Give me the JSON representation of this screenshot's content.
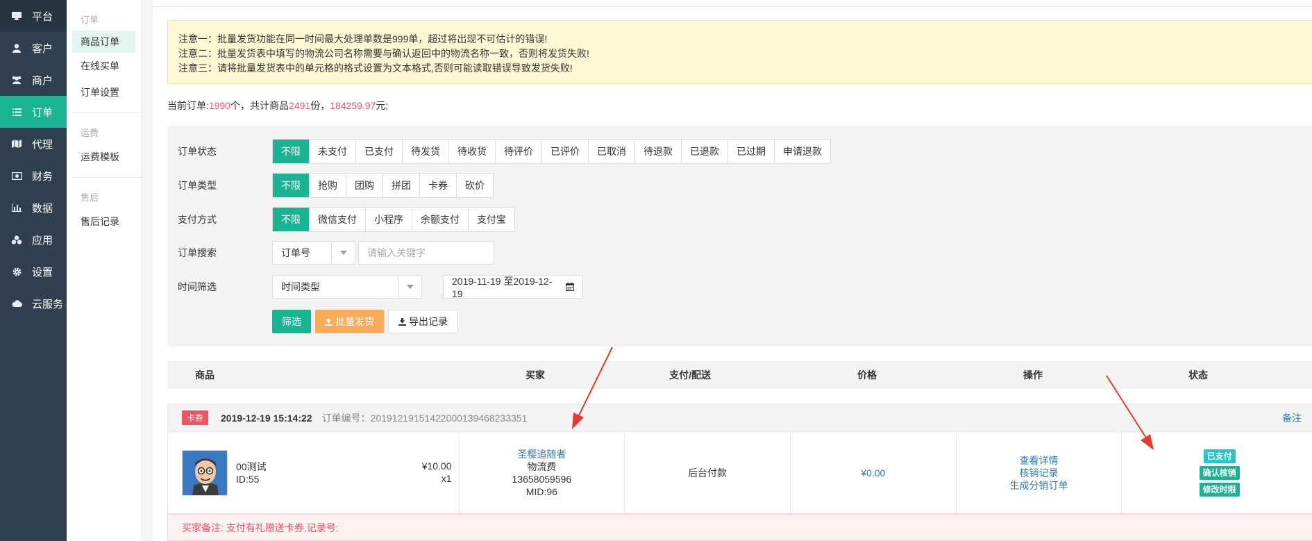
{
  "sidebar": {
    "items": [
      {
        "label": "平台",
        "icon": "monitor-icon"
      },
      {
        "label": "客户",
        "icon": "user-icon"
      },
      {
        "label": "商户",
        "icon": "users-icon"
      },
      {
        "label": "订单",
        "icon": "list-icon"
      },
      {
        "label": "代理",
        "icon": "map-icon"
      },
      {
        "label": "财务",
        "icon": "money-icon"
      },
      {
        "label": "数据",
        "icon": "bar-chart-icon"
      },
      {
        "label": "应用",
        "icon": "cubes-icon"
      },
      {
        "label": "设置",
        "icon": "gear-icon"
      },
      {
        "label": "云服务",
        "icon": "cloud-icon"
      }
    ],
    "active": "订单"
  },
  "subnav": {
    "group_order": "订单",
    "order_items": [
      "商品订单",
      "在线买单",
      "订单设置"
    ],
    "group_freight": "运费",
    "freight_items": [
      "运费模板"
    ],
    "group_aftersale": "售后",
    "aftersale_items": [
      "售后记录"
    ]
  },
  "notice": {
    "line1": "注意一：批量发货功能在同一时间最大处理单数是999单，超过将出现不可估计的错误!",
    "line2": "注意二：批量发货表中填写的物流公司名称需要与确认返回中的物流名称一致，否则将发货失败!",
    "line3": "注意三：请将批量发货表中的单元格的格式设置为文本格式,否则可能读取错误导致发货失败!"
  },
  "summary": {
    "prefix": "当前订单:",
    "order_count": "1990",
    "mid1": "个，共计商品",
    "goods_count": "2491",
    "mid2": "份，",
    "amount": "184259.97",
    "suffix": "元;"
  },
  "filters": {
    "status_label": "订单状态",
    "status_options": [
      "不限",
      "未支付",
      "已支付",
      "待发货",
      "待收货",
      "待评价",
      "已评价",
      "已取消",
      "待退款",
      "已退款",
      "已过期",
      "申请退款"
    ],
    "type_label": "订单类型",
    "type_options": [
      "不限",
      "抢购",
      "团购",
      "拼团",
      "卡券",
      "砍价"
    ],
    "pay_label": "支付方式",
    "pay_options": [
      "不限",
      "微信支付",
      "小程序",
      "余额支付",
      "支付宝"
    ],
    "search_label": "订单搜索",
    "search_field": "订单号",
    "search_placeholder": "请输入关键字",
    "time_label": "时间筛选",
    "time_type": "时间类型",
    "date_range": "2019-11-19 至2019-12-19",
    "btn_filter": "筛选",
    "btn_batch": "批量发货",
    "btn_export": "导出记录"
  },
  "table": {
    "headers": [
      "商品",
      "买家",
      "支付/配送",
      "价格",
      "操作",
      "状态"
    ]
  },
  "order": {
    "badge": "卡券",
    "datetime": "2019-12-19 15:14:22",
    "order_no": "订单编号：20191219151422000139468233351",
    "remark_link": "备注",
    "goods_name": "00测试",
    "goods_id": "ID:55",
    "goods_price": "¥10.00",
    "goods_qty": "x1",
    "buyer_name": "圣樱追随者",
    "buyer_fee": "物流费",
    "buyer_phone": "13658059596",
    "buyer_mid": "MID:96",
    "pay_method": "后台付款",
    "price": "¥0.00",
    "op_detail": "查看详情",
    "op_verify_log": "核销记录",
    "op_gen_dist": "生成分销订单",
    "status_paid": "已支付",
    "status_confirm": "确认核销",
    "status_modify": "修改时限",
    "buyer_note": "买家备注: 支付有礼赠送卡券,记录号:"
  },
  "colors": {
    "sidebar_bg": "#2f4050",
    "accent": "#1ab394",
    "warning": "#f8ac59",
    "danger": "#ed5565",
    "link": "#337ab7",
    "arrow": "#e8392e"
  }
}
